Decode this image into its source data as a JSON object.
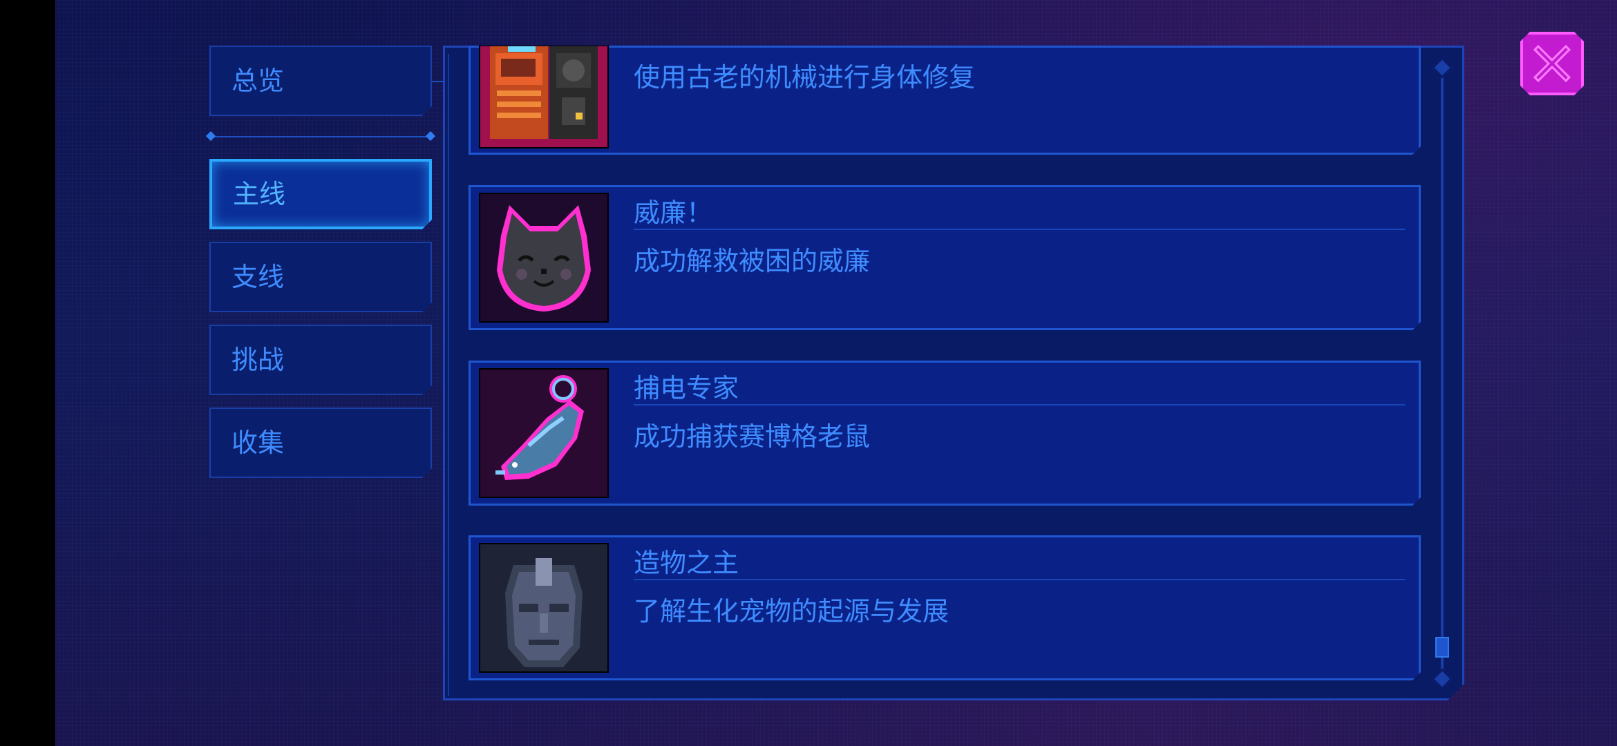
{
  "sidebar": {
    "overview": "总览",
    "items": [
      {
        "label": "主线",
        "active": true
      },
      {
        "label": "支线",
        "active": false
      },
      {
        "label": "挑战",
        "active": false
      },
      {
        "label": "收集",
        "active": false
      }
    ]
  },
  "achievements": [
    {
      "title": "",
      "desc": "使用古老的机械进行身体修复",
      "icon": "machine-icon"
    },
    {
      "title": "威廉！",
      "desc": "成功解救被困的威廉",
      "icon": "cat-face-icon"
    },
    {
      "title": "捕电专家",
      "desc": "成功捕获赛博格老鼠",
      "icon": "cyber-rat-icon"
    },
    {
      "title": "造物之主",
      "desc": "了解生化宠物的起源与发展",
      "icon": "statue-head-icon"
    }
  ],
  "colors": {
    "accent": "#3f8cff",
    "close": "#c21bd0",
    "panel": "#0a1b66"
  }
}
